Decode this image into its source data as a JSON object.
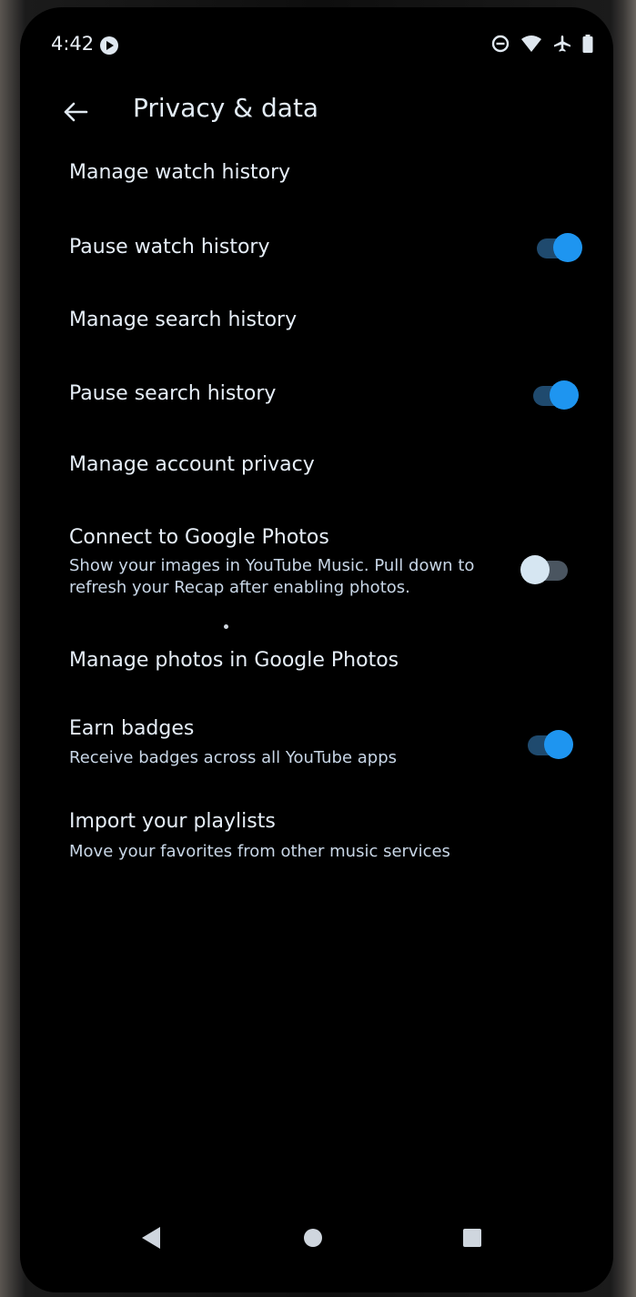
{
  "status_bar": {
    "time": "4:42",
    "icons": [
      "youtube-music-app-icon",
      "do-not-disturb-icon",
      "wifi-icon",
      "airplane-mode-icon",
      "battery-icon"
    ]
  },
  "app_bar": {
    "back_icon": "arrow-back-icon",
    "title": "Privacy & data"
  },
  "settings": {
    "manage_watch_history": {
      "title": "Manage watch history"
    },
    "pause_watch_history": {
      "title": "Pause watch history",
      "toggle": true
    },
    "manage_search_history": {
      "title": "Manage search history"
    },
    "pause_search_history": {
      "title": "Pause search history",
      "toggle": true
    },
    "manage_account_privacy": {
      "title": "Manage account privacy"
    },
    "connect_google_photos": {
      "title": "Connect to Google Photos",
      "subtitle": "Show your images in YouTube Music. Pull down to refresh your Recap after enabling photos.",
      "toggle": false
    },
    "manage_photos": {
      "title": "Manage photos in Google Photos"
    },
    "earn_badges": {
      "title": "Earn badges",
      "subtitle": "Receive badges across all YouTube apps",
      "toggle": true
    },
    "import_playlists": {
      "title": "Import your playlists",
      "subtitle": "Move your favorites from other music services"
    }
  },
  "nav_bar": {
    "icons": [
      "nav-back-icon",
      "nav-home-icon",
      "nav-recents-icon"
    ]
  },
  "colors": {
    "background": "#000000",
    "text_primary": "#e6eef7",
    "text_secondary": "#c8d6e6",
    "toggle_on_thumb": "#1e95f0",
    "toggle_on_track": "#1f4a6e",
    "toggle_off_thumb": "#d6e6f2",
    "toggle_off_track": "#4a5560"
  }
}
